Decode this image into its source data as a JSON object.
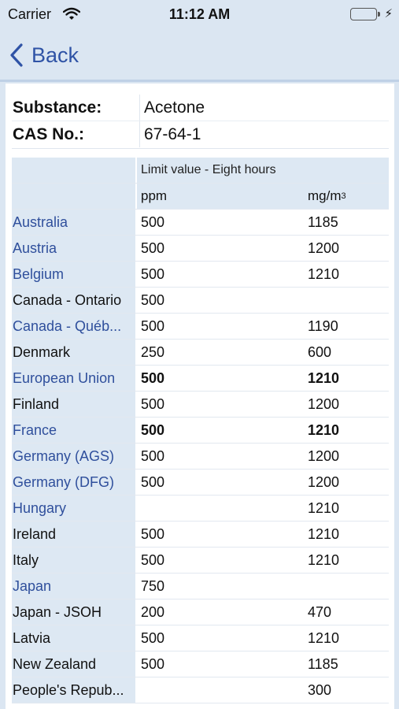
{
  "status": {
    "carrier": "Carrier",
    "time": "11:12 AM"
  },
  "nav": {
    "back_label": "Back"
  },
  "substance": {
    "label": "Substance:",
    "value": "Acetone"
  },
  "cas": {
    "label": "CAS No.:",
    "value": "67-64-1"
  },
  "table": {
    "group_header": "Limit value - Eight hours",
    "col_ppm": "ppm",
    "col_mg": "mg/m",
    "col_mg_sup": "3",
    "rows": [
      {
        "country": "Australia",
        "ppm": "500",
        "mg": "1185",
        "link": true,
        "bold": false
      },
      {
        "country": "Austria",
        "ppm": "500",
        "mg": "1200",
        "link": true,
        "bold": false
      },
      {
        "country": "Belgium",
        "ppm": "500",
        "mg": "1210",
        "link": true,
        "bold": false
      },
      {
        "country": "Canada - Ontario",
        "ppm": "500",
        "mg": "",
        "link": false,
        "bold": false
      },
      {
        "country": "Canada - Québ...",
        "ppm": "500",
        "mg": "1190",
        "link": true,
        "bold": false
      },
      {
        "country": "Denmark",
        "ppm": "250",
        "mg": "600",
        "link": false,
        "bold": false
      },
      {
        "country": "European Union",
        "ppm": "500",
        "mg": "1210",
        "link": true,
        "bold": true
      },
      {
        "country": "Finland",
        "ppm": "500",
        "mg": "1200",
        "link": false,
        "bold": false
      },
      {
        "country": "France",
        "ppm": "500",
        "mg": "1210",
        "link": true,
        "bold": true
      },
      {
        "country": "Germany (AGS)",
        "ppm": "500",
        "mg": "1200",
        "link": true,
        "bold": false
      },
      {
        "country": "Germany (DFG)",
        "ppm": "500",
        "mg": "1200",
        "link": true,
        "bold": false
      },
      {
        "country": "Hungary",
        "ppm": "",
        "mg": "1210",
        "link": true,
        "bold": false
      },
      {
        "country": "Ireland",
        "ppm": "500",
        "mg": "1210",
        "link": false,
        "bold": false
      },
      {
        "country": "Italy",
        "ppm": "500",
        "mg": "1210",
        "link": false,
        "bold": false
      },
      {
        "country": "Japan",
        "ppm": "750",
        "mg": "",
        "link": true,
        "bold": false
      },
      {
        "country": "Japan - JSOH",
        "ppm": "200",
        "mg": "470",
        "link": false,
        "bold": false
      },
      {
        "country": "Latvia",
        "ppm": "500",
        "mg": "1210",
        "link": false,
        "bold": false
      },
      {
        "country": "New Zealand",
        "ppm": "500",
        "mg": "1185",
        "link": false,
        "bold": false
      },
      {
        "country": "People's Repub...",
        "ppm": "",
        "mg": "300",
        "link": false,
        "bold": false
      }
    ]
  }
}
